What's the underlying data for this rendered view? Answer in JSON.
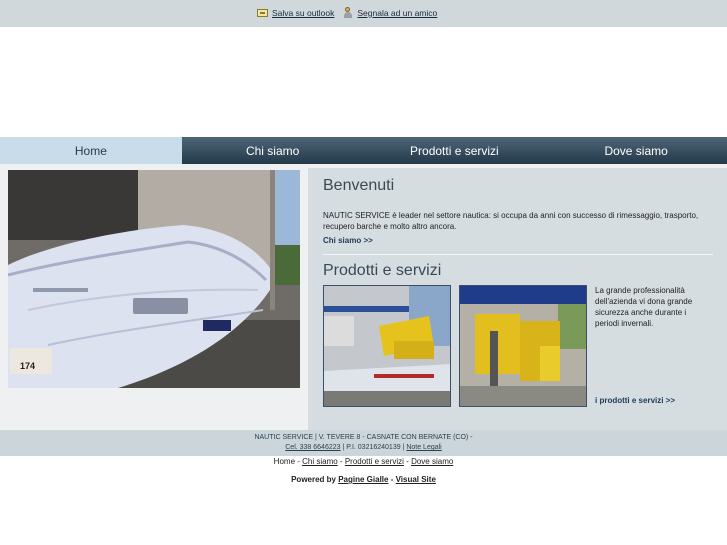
{
  "top_links": {
    "outlook_label": "Salva su outlook",
    "friend_label": "Segnala ad un amico"
  },
  "nav": {
    "items": [
      {
        "label": "Home"
      },
      {
        "label": "Chi siamo"
      },
      {
        "label": "Prodotti e servizi"
      },
      {
        "label": "Dove siamo"
      }
    ]
  },
  "welcome": {
    "title": "Benvenuti",
    "text": "NAUTIC SERVICE è leader nel settore nautica: si occupa da anni con successo di rimessaggio, trasporto, recupero barche e molto altro ancora.",
    "more_label": "Chi siamo >>"
  },
  "products": {
    "title": "Prodotti e servizi",
    "text": "La grande professionalità dell'azienda vi dona grande sicurezza anche durante i periodi invernali.",
    "more_label": "i prodotti e servizi >>"
  },
  "hero": {
    "boat_tag": "174"
  },
  "footer": {
    "line1": "NAUTIC SERVICE | V. TEVERE 8 - CASNATE CON BERNATE (CO) -",
    "phone": "Cel. 338 6646223",
    "vat": " | P.I. 03216240139 | ",
    "legal": "Note Legali"
  },
  "bottom_nav": {
    "home": "Home",
    "chi_siamo": "Chi siamo",
    "prodotti": "Prodotti e servizi",
    "dove_siamo": "Dove siamo",
    "sep": " - "
  },
  "powered": {
    "prefix": "Powered by ",
    "pagine_gialle": "Pagine Gialle",
    "sep": " - ",
    "visual_site": "Visual Site"
  },
  "colors": {
    "nav_dark": "#24394a",
    "nav_active": "#c9dcea",
    "panel": "#d6dde0",
    "footer": "#ccd6da"
  }
}
